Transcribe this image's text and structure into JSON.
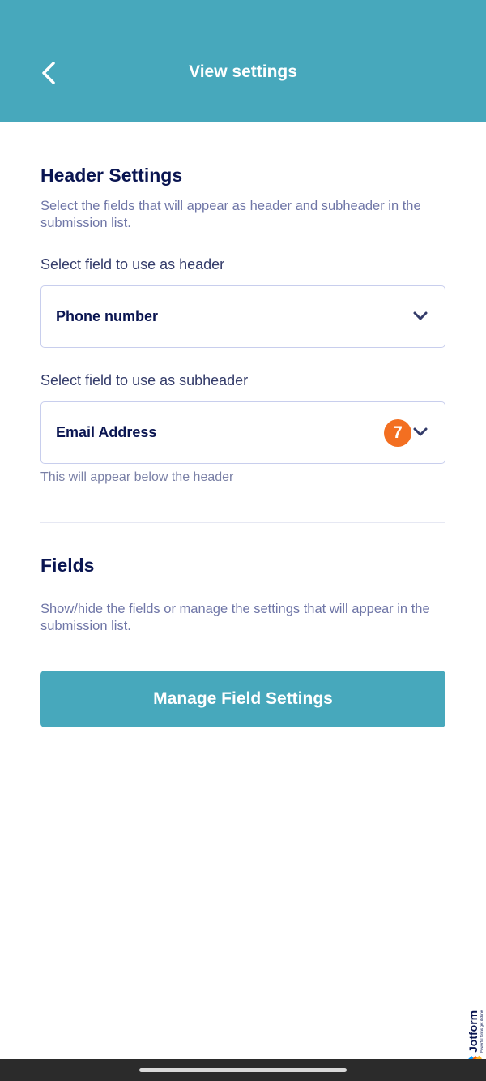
{
  "header": {
    "title": "View settings",
    "back_icon": "chevron-left-icon"
  },
  "header_settings": {
    "title": "Header Settings",
    "description": "Select the fields that will appear as header and subheader in the submission list.",
    "header_field": {
      "label": "Select field to use as header",
      "value": "Phone number",
      "icon": "chevron-down-icon"
    },
    "subheader_field": {
      "label": "Select field to use as subheader",
      "value": "Email Address",
      "icon": "chevron-down-icon",
      "hint": "This will appear below the header"
    }
  },
  "fields": {
    "title": "Fields",
    "description": "Show/hide the fields or manage the settings that will appear in the submission list.",
    "button_label": "Manage Field Settings"
  },
  "step_badge": "7",
  "watermark": {
    "brand": "Jotform",
    "tagline": "Powerful forms get it done"
  },
  "colors": {
    "accent": "#47a8bc",
    "badge": "#f36f21",
    "text_dark": "#0a1551",
    "text_muted": "#6f76a7"
  }
}
